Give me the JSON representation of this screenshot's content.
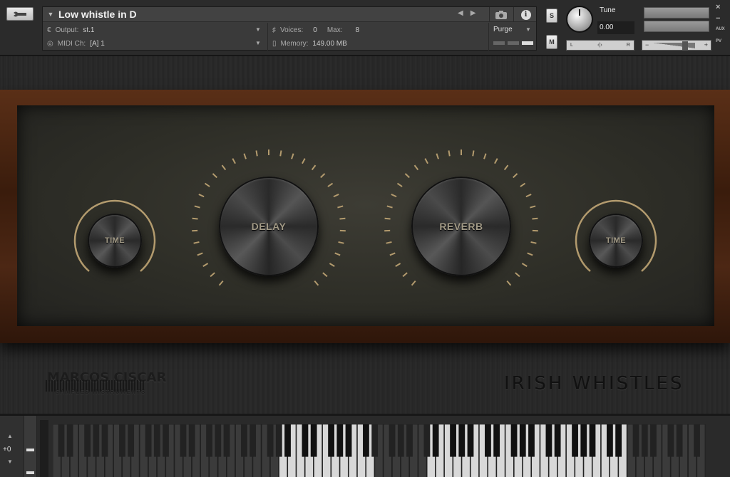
{
  "header": {
    "instrument_title": "Low whistle in D",
    "output_label": "Output:",
    "output_value": "st.1",
    "voices_label": "Voices:",
    "voices_value": "0",
    "max_label": "Max:",
    "max_value": "8",
    "midi_label": "MIDI Ch:",
    "midi_value": "[A]  1",
    "memory_label": "Memory:",
    "memory_value": "149.00 MB",
    "purge_label": "Purge",
    "solo_label": "S",
    "mute_label": "M",
    "tune_label": "Tune",
    "tune_value": "0.00",
    "pan_left": "L",
    "pan_center": "‹|›",
    "pan_right": "R",
    "vol_minus": "−",
    "vol_plus": "+",
    "close_label": "×",
    "minimize_label": "−",
    "aux_label": "AUX",
    "pv_label": "PV"
  },
  "controls": {
    "left_time_label": "TIME",
    "delay_label": "DELAY",
    "reverb_label": "REVERB",
    "right_time_label": "TIME"
  },
  "branding": {
    "maker_name": "MARCOS CISCAR",
    "maker_sub": "SAMPLED INSTRUMENTS",
    "product_name": "IRISH WHISTLES"
  },
  "keyboard": {
    "octave_value": "+0",
    "active_ranges": [
      [
        26,
        36
      ],
      [
        43,
        65
      ]
    ]
  },
  "colors": {
    "knob_tick": "#b39b6e",
    "knob_label": "#a29a86",
    "wood": "#4c2714"
  }
}
